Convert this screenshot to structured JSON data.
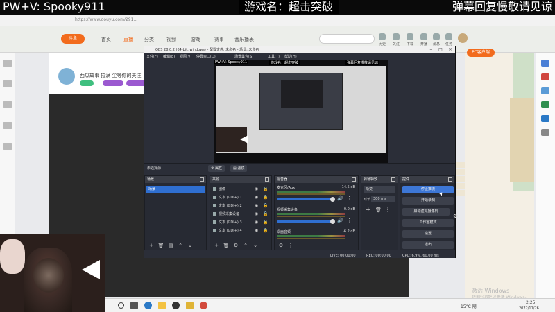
{
  "overlay": {
    "contact": "PW+V: Spooky911",
    "game": "游戏名：超击突破",
    "danmu": "弹幕回复慢敬请见谅"
  },
  "browser": {
    "url": "https://www.douyu.com/291...",
    "nav": [
      "首页",
      "直播",
      "分类",
      "视频",
      "游戏",
      "赛事",
      "音乐播表"
    ],
    "header_icons": [
      "历史",
      "关注",
      "下载",
      "开播",
      "消息",
      "任务"
    ],
    "stream_title": "西瓜故事 拉满 尘等你的关注",
    "pc_mode": "PC客户端",
    "activate_title": "激活 Windows",
    "activate_sub": "转到\"设置\"以激活 Windows。"
  },
  "obs": {
    "title": "OBS 28.0.2 (64-bit, windows) - 配置文件: 未命名 - 场景: 未命名",
    "menus": [
      "文件(F)",
      "编辑(E)",
      "视图(V)",
      "停靠窗口(D)",
      "场景集合(S)",
      "工具(T)",
      "帮助(H)"
    ],
    "preview_overlay": [
      "PW+V: Spooky911",
      "游戏名：超击突破",
      "弹幕回复慢敬请见谅"
    ],
    "no_source": "未选择源",
    "properties_btn": "属性",
    "filters_btn": "滤镜",
    "scenes": {
      "title": "场景",
      "items": [
        "场景"
      ]
    },
    "sources": {
      "title": "来源",
      "items": [
        "图像",
        "文本 (GDI+) 1",
        "文本 (GDI+) 2",
        "视频采集设备",
        "文本 (GDI+) 3",
        "文本 (GDI+) 4"
      ]
    },
    "mixer": {
      "title": "混音器",
      "channels": [
        {
          "name": "麦克风/Aux",
          "db": "14.5 dB"
        },
        {
          "name": "视频采集设备",
          "db": "0.0 dB"
        },
        {
          "name": "桌面音频",
          "db": "-6.2 dB"
        }
      ]
    },
    "transitions": {
      "title": "转场特效",
      "selected": "渐变",
      "duration_label": "时长",
      "duration": "300 ms"
    },
    "controls": {
      "title": "控件",
      "buttons": [
        "停止推流",
        "开始录制",
        "启动虚拟摄像机",
        "工作室模式",
        "设置",
        "退出"
      ]
    },
    "status": {
      "live": "LIVE: 00:00:00",
      "rec": "REC: 00:00:00",
      "cpu": "CPU: 6.9%, 60.00 fps"
    }
  },
  "taskbar": {
    "weather": "15°C 阴",
    "time": "2:25",
    "date": "2022/11/26"
  },
  "colors": {
    "obs_bg": "#2b2e38",
    "accent_blue": "#3d77d6",
    "douyu_orange": "#f26b1d"
  }
}
